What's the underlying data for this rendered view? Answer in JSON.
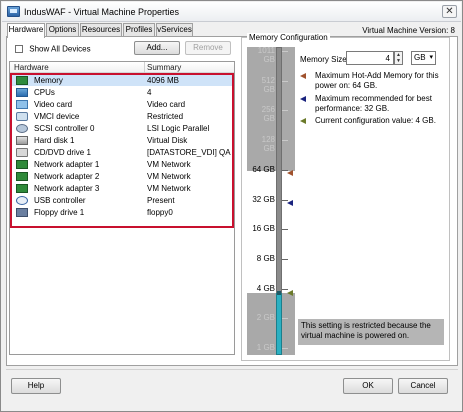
{
  "window": {
    "title": "IndusWAF - Virtual Machine Properties",
    "vm_version": "Virtual Machine Version: 8"
  },
  "tabs": [
    {
      "label": "Hardware",
      "active": true
    },
    {
      "label": "Options",
      "active": false
    },
    {
      "label": "Resources",
      "active": false
    },
    {
      "label": "Profiles",
      "active": false
    },
    {
      "label": "vServices",
      "active": false
    }
  ],
  "hardware_panel": {
    "show_all_devices_label": "Show All Devices",
    "show_all_devices_checked": false,
    "add_button": "Add...",
    "remove_button": "Remove",
    "columns": [
      "Hardware",
      "Summary"
    ],
    "rows": [
      {
        "icon": "memory-icon",
        "name": "Memory",
        "summary": "4096 MB",
        "selected": true
      },
      {
        "icon": "cpu-icon",
        "name": "CPUs",
        "summary": "4"
      },
      {
        "icon": "video-card-icon",
        "name": "Video card",
        "summary": "Video card"
      },
      {
        "icon": "vmci-device-icon",
        "name": "VMCI device",
        "summary": "Restricted"
      },
      {
        "icon": "scsi-controller-icon",
        "name": "SCSI controller 0",
        "summary": "LSI Logic Parallel"
      },
      {
        "icon": "hard-disk-icon",
        "name": "Hard disk 1",
        "summary": "Virtual Disk"
      },
      {
        "icon": "cd-dvd-icon",
        "name": "CD/DVD drive 1",
        "summary": "[DATASTORE_VDI] QA..."
      },
      {
        "icon": "network-adapter-icon",
        "name": "Network adapter 1",
        "summary": "VM Network"
      },
      {
        "icon": "network-adapter-icon",
        "name": "Network adapter 2",
        "summary": "VM Network"
      },
      {
        "icon": "network-adapter-icon",
        "name": "Network adapter 3",
        "summary": "VM Network"
      },
      {
        "icon": "usb-controller-icon",
        "name": "USB controller",
        "summary": "Present"
      },
      {
        "icon": "floppy-drive-icon",
        "name": "Floppy drive 1",
        "summary": "floppy0"
      }
    ],
    "highlight_color": "#c8102e"
  },
  "memory_config": {
    "group_title": "Memory Configuration",
    "size_label": "Memory Size:",
    "size_value": "4",
    "unit": "GB",
    "legend": [
      {
        "text": "Maximum Hot-Add Memory for this power on: 64 GB.",
        "color": "#a0522d"
      },
      {
        "text": "Maximum recommended for best performance: 32 GB.",
        "color": "#1a237e"
      },
      {
        "text": "Current configuration value: 4 GB.",
        "color": "#6b7a2a"
      }
    ],
    "scale_ticks": [
      {
        "label": "1011 GB",
        "muted": true
      },
      {
        "label": "512 GB",
        "muted": true
      },
      {
        "label": "256 GB",
        "muted": true
      },
      {
        "label": "128 GB",
        "muted": true
      },
      {
        "label": "64 GB",
        "muted": false
      },
      {
        "label": "32 GB",
        "muted": false
      },
      {
        "label": "16 GB",
        "muted": false
      },
      {
        "label": "8 GB",
        "muted": false
      },
      {
        "label": "4 GB",
        "muted": false
      },
      {
        "label": "2 GB",
        "muted": true
      },
      {
        "label": "1 GB",
        "muted": true
      }
    ],
    "current_value_gb": 4,
    "restricted_note": "This setting is restricted because the virtual machine is powered on.",
    "fill_color": "#2bb0c2"
  },
  "footer": {
    "help_button": "Help",
    "ok_button": "OK",
    "cancel_button": "Cancel"
  }
}
